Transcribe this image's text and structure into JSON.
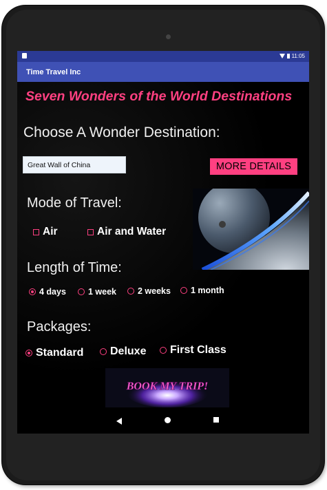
{
  "statusbar": {
    "time": "11:05",
    "wifi_icon": "wifi-icon",
    "battery_icon": "battery-icon"
  },
  "appbar": {
    "title": "Time Travel Inc"
  },
  "main": {
    "heading": "Seven Wonders of the World Destinations",
    "choose_label": "Choose A Wonder Destination:",
    "destination_value": "Great Wall of China",
    "more_details_label": "MORE DETAILS",
    "mode_label": "Mode of Travel:",
    "mode_options": [
      {
        "label": "Air",
        "checked": false
      },
      {
        "label": "Air and Water",
        "checked": false
      }
    ],
    "length_label": "Length of Time:",
    "length_options": [
      {
        "label": "4 days",
        "selected": true
      },
      {
        "label": "1 week",
        "selected": false
      },
      {
        "label": "2 weeks",
        "selected": false
      },
      {
        "label": "1 month",
        "selected": false
      }
    ],
    "packages_label": "Packages:",
    "package_options": [
      {
        "label": "Standard",
        "selected": true
      },
      {
        "label": "Deluxe",
        "selected": false
      },
      {
        "label": "First Class",
        "selected": false
      }
    ],
    "book_button_text": "BOOK MY TRIP!"
  },
  "colors": {
    "accent": "#ff4081",
    "primary": "#3f51b5",
    "status_bar": "#2b3a95",
    "background": "#000000"
  }
}
